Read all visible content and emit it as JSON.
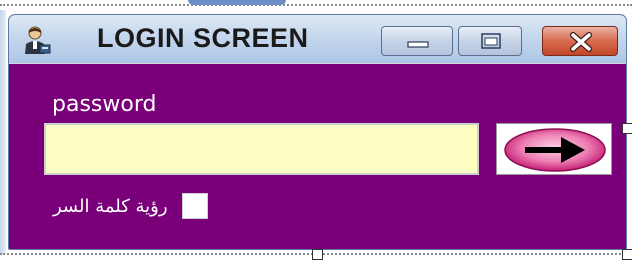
{
  "window": {
    "title": "LOGIN SCREEN",
    "icon": "user-icon",
    "controls": {
      "minimize_icon": "minimize-icon",
      "maximize_icon": "maximize-icon",
      "close_icon": "close-icon"
    }
  },
  "form": {
    "password_label": "password",
    "password_value": "",
    "submit_icon": "arrow-right-icon",
    "show_password_label": "رؤية كلمة السر",
    "show_password_checked": false
  },
  "colors": {
    "window_background": "#7a007a",
    "input_background": "#ffffc4",
    "close_button": "#c2472a",
    "submit_ellipse": "#e05a9c"
  }
}
